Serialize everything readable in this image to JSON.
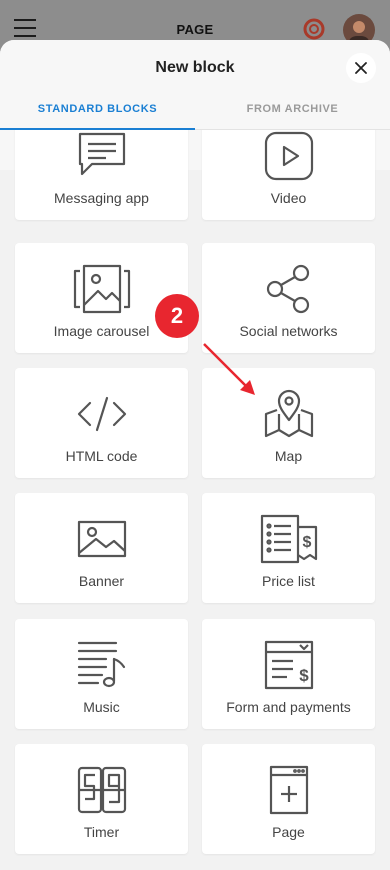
{
  "header": {
    "page_label": "PAGE",
    "menu_icon": "hamburger-icon",
    "help_icon": "lifebuoy-icon",
    "avatar": "user-avatar"
  },
  "sheet": {
    "title": "New block",
    "close_icon": "close-icon",
    "tabs": [
      {
        "label": "STANDARD BLOCKS",
        "active": true
      },
      {
        "label": "FROM ARCHIVE",
        "active": false
      }
    ]
  },
  "blocks": [
    {
      "label": "Messaging app",
      "icon": "chat-bubble-icon"
    },
    {
      "label": "Video",
      "icon": "play-icon"
    },
    {
      "label": "Image carousel",
      "icon": "image-carousel-icon"
    },
    {
      "label": "Social networks",
      "icon": "share-icon"
    },
    {
      "label": "HTML code",
      "icon": "code-icon"
    },
    {
      "label": "Map",
      "icon": "map-pin-icon"
    },
    {
      "label": "Banner",
      "icon": "image-icon"
    },
    {
      "label": "Price list",
      "icon": "price-list-icon"
    },
    {
      "label": "Music",
      "icon": "music-icon"
    },
    {
      "label": "Form and payments",
      "icon": "form-payment-icon"
    },
    {
      "label": "Timer",
      "icon": "flip-timer-icon"
    },
    {
      "label": "Page",
      "icon": "add-page-icon"
    }
  ],
  "annotation": {
    "step_number": "2",
    "color": "#e8262f"
  },
  "colors": {
    "accent": "#1a7fd3",
    "icon_stroke": "#555555"
  }
}
